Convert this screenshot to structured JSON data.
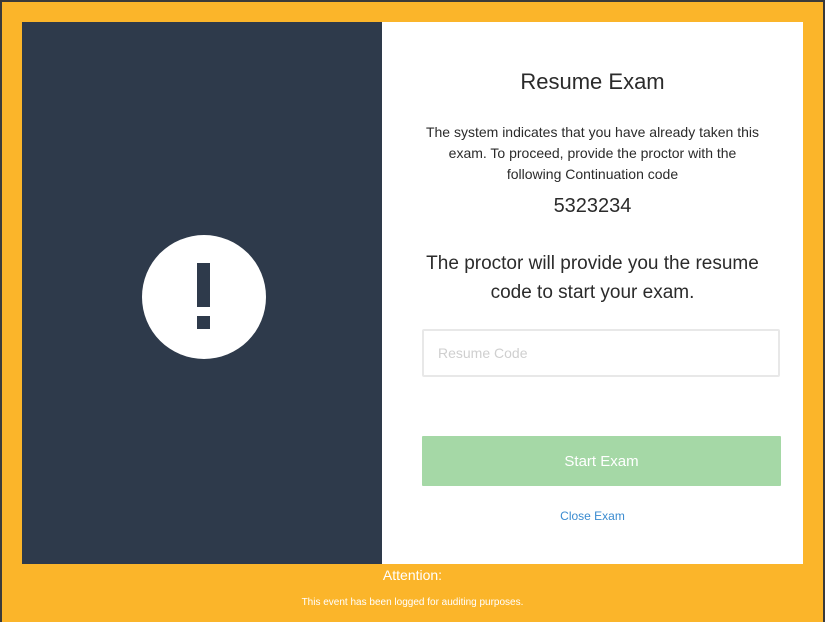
{
  "dialog": {
    "title": "Resume Exam",
    "message": "The system indicates that you have already taken this exam. To proceed, provide the proctor with the following Continuation code",
    "continuation_code": "5323234",
    "instruction": "The proctor will provide you the resume code to start your exam.",
    "resume_code": {
      "placeholder": "Resume Code",
      "value": ""
    },
    "start_button_label": "Start Exam",
    "close_link_label": "Close Exam"
  },
  "footer": {
    "title": "Attention:",
    "note": "This event has been logged for auditing purposes."
  },
  "icons": {
    "alert": "exclamation-icon"
  },
  "colors": {
    "frame": "#fbb52a",
    "left_panel": "#2e3a4b",
    "start_button": "#a5d8a6",
    "link": "#3a8bd0"
  }
}
